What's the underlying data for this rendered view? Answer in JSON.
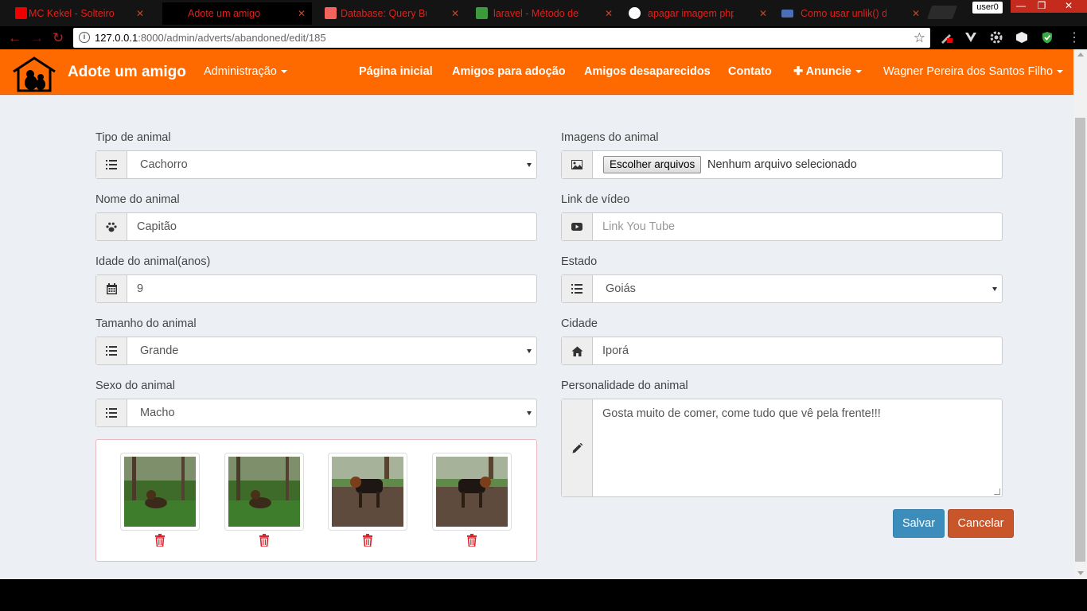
{
  "browser": {
    "tabs": [
      {
        "title": "MC Kekel - Solteiro Já",
        "icon": "youtube-icon"
      },
      {
        "title": "Adote um amigo",
        "icon": "paw-tab-icon",
        "active": true
      },
      {
        "title": "Database: Query Builde",
        "icon": "laravel-icon"
      },
      {
        "title": "laravel - Método delete",
        "icon": "stackoverflow-icon"
      },
      {
        "title": "apagar imagem php - Pe",
        "icon": "google-icon"
      },
      {
        "title": "Como usar unlik() do ph",
        "icon": "php-icon"
      }
    ],
    "user": "user0",
    "window_controls": {
      "minimize": "—",
      "maximize": "❐",
      "close": "✕"
    },
    "url_host": "127.0.0.1",
    "url_path": ":8000/admin/adverts/abandoned/edit/185"
  },
  "navbar": {
    "brand": "Adote um amigo",
    "admin_menu": "Administração",
    "links": [
      "Página inicial",
      "Amigos para adoção",
      "Amigos desaparecidos",
      "Contato"
    ],
    "advertise_menu": "Anuncie",
    "advertise_icon": "✚",
    "user_menu": "Wagner Pereira dos Santos Filho"
  },
  "form": {
    "animal_type": {
      "label": "Tipo de animal",
      "value": "Cachorro",
      "icon": "list-icon"
    },
    "animal_name": {
      "label": "Nome do animal",
      "value": "Capitão",
      "icon": "paw-icon"
    },
    "animal_age": {
      "label": "Idade do animal(anos)",
      "value": "9",
      "icon": "calendar-icon"
    },
    "animal_size": {
      "label": "Tamanho do animal",
      "value": "Grande",
      "icon": "list-icon"
    },
    "animal_sex": {
      "label": "Sexo do animal",
      "value": "Macho",
      "icon": "list-icon"
    },
    "images": {
      "label": "Imagens do animal",
      "button": "Escolher arquivos",
      "status": "Nenhum arquivo selecionado",
      "icon": "image-icon"
    },
    "video": {
      "label": "Link de vídeo",
      "placeholder": "Link You Tube",
      "icon": "youtube-icon"
    },
    "state": {
      "label": "Estado",
      "value": "Goiás",
      "icon": "list-icon"
    },
    "city": {
      "label": "Cidade",
      "value": "Iporá",
      "icon": "home-icon"
    },
    "personality": {
      "label": "Personalidade do animal",
      "value": "Gosta muito de comer, come tudo que vê pela frente!!!",
      "icon": "pencil-icon"
    }
  },
  "gallery": {
    "count": 4
  },
  "actions": {
    "save": "Salvar",
    "cancel": "Cancelar"
  },
  "colors": {
    "navbar": "#ff6a00",
    "primary": "#3c8dbc",
    "danger": "#c9552b",
    "tab_text": "#e0211b"
  }
}
